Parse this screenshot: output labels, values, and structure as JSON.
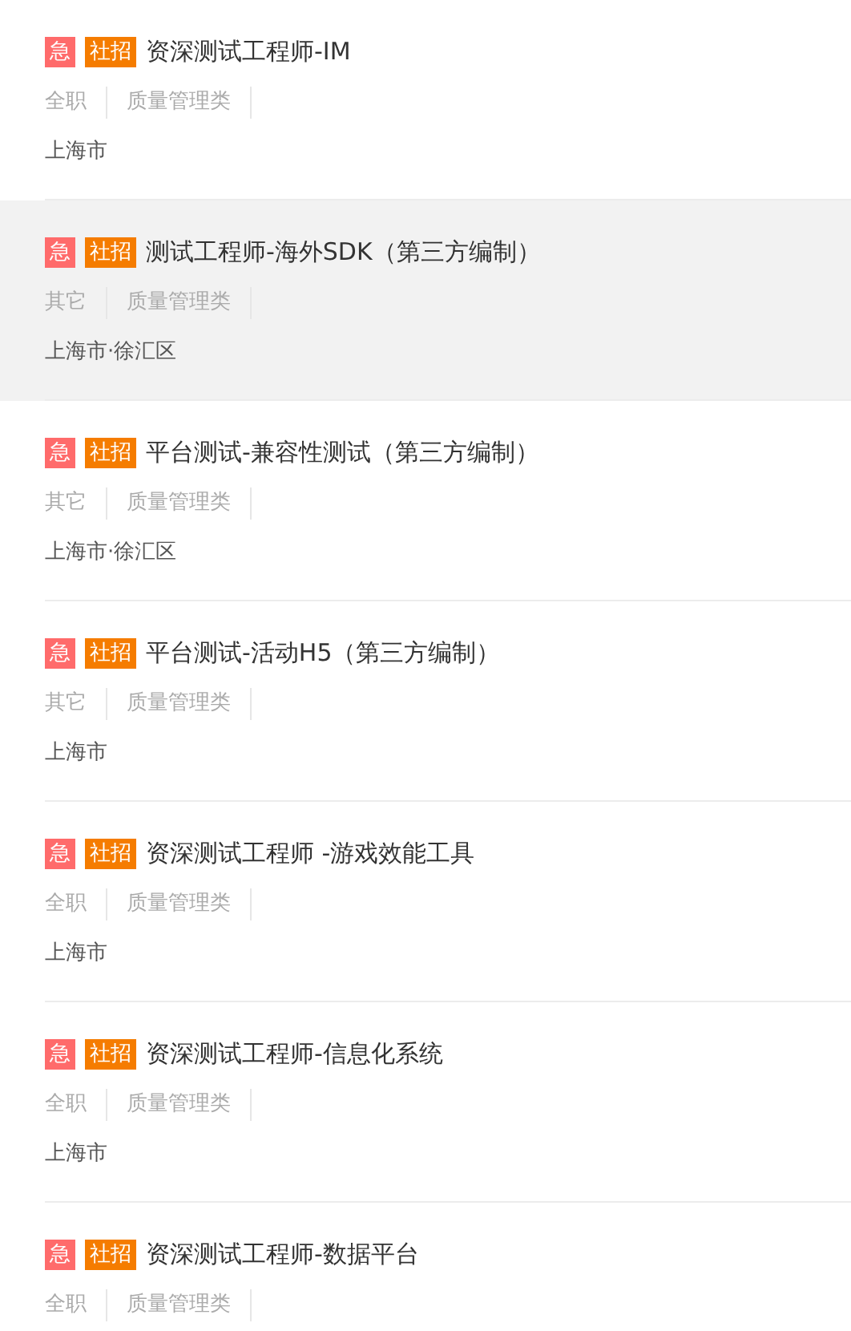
{
  "jobs": [
    {
      "badges": [
        {
          "label": "急",
          "kind": "urgent"
        },
        {
          "label": "社招",
          "kind": "social"
        }
      ],
      "title": "资深测试工程师-IM",
      "meta": [
        "全职",
        "质量管理类"
      ],
      "location": "上海市",
      "highlighted": false
    },
    {
      "badges": [
        {
          "label": "急",
          "kind": "urgent"
        },
        {
          "label": "社招",
          "kind": "social"
        }
      ],
      "title": "测试工程师-海外SDK（第三方编制）",
      "meta": [
        "其它",
        "质量管理类"
      ],
      "location": "上海市·徐汇区",
      "highlighted": true
    },
    {
      "badges": [
        {
          "label": "急",
          "kind": "urgent"
        },
        {
          "label": "社招",
          "kind": "social"
        }
      ],
      "title": "平台测试-兼容性测试（第三方编制）",
      "meta": [
        "其它",
        "质量管理类"
      ],
      "location": "上海市·徐汇区",
      "highlighted": false
    },
    {
      "badges": [
        {
          "label": "急",
          "kind": "urgent"
        },
        {
          "label": "社招",
          "kind": "social"
        }
      ],
      "title": "平台测试-活动H5（第三方编制）",
      "meta": [
        "其它",
        "质量管理类"
      ],
      "location": "上海市",
      "highlighted": false
    },
    {
      "badges": [
        {
          "label": "急",
          "kind": "urgent"
        },
        {
          "label": "社招",
          "kind": "social"
        }
      ],
      "title": "资深测试工程师 -游戏效能工具",
      "meta": [
        "全职",
        "质量管理类"
      ],
      "location": "上海市",
      "highlighted": false
    },
    {
      "badges": [
        {
          "label": "急",
          "kind": "urgent"
        },
        {
          "label": "社招",
          "kind": "social"
        }
      ],
      "title": "资深测试工程师-信息化系统",
      "meta": [
        "全职",
        "质量管理类"
      ],
      "location": "上海市",
      "highlighted": false
    },
    {
      "badges": [
        {
          "label": "急",
          "kind": "urgent"
        },
        {
          "label": "社招",
          "kind": "social"
        }
      ],
      "title": "资深测试工程师-数据平台",
      "meta": [
        "全职",
        "质量管理类"
      ],
      "highlighted": false
    }
  ]
}
